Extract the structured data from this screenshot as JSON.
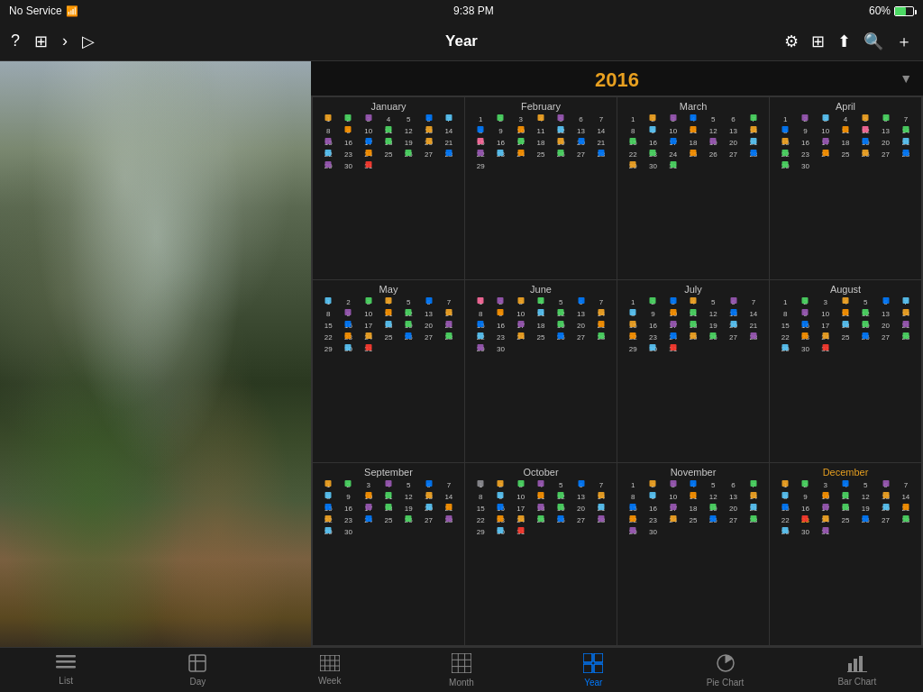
{
  "status_bar": {
    "carrier": "No Service",
    "time": "9:38 PM",
    "battery": "60%"
  },
  "nav_bar": {
    "title": "Year",
    "back_label": "‹",
    "icons": [
      "gear",
      "grid",
      "share",
      "search",
      "plus"
    ]
  },
  "calendar": {
    "year": "2016",
    "months": [
      {
        "name": "January",
        "is_current": false
      },
      {
        "name": "February",
        "is_current": false
      },
      {
        "name": "March",
        "is_current": false
      },
      {
        "name": "April",
        "is_current": false
      },
      {
        "name": "May",
        "is_current": false
      },
      {
        "name": "June",
        "is_current": false
      },
      {
        "name": "July",
        "is_current": false
      },
      {
        "name": "August",
        "is_current": false
      },
      {
        "name": "September",
        "is_current": false
      },
      {
        "name": "October",
        "is_current": false
      },
      {
        "name": "November",
        "is_current": false
      },
      {
        "name": "December",
        "is_current": true
      }
    ]
  },
  "tabs": [
    {
      "label": "List",
      "icon": "☰",
      "active": false
    },
    {
      "label": "Day",
      "icon": "▤",
      "active": false
    },
    {
      "label": "Week",
      "icon": "▦",
      "active": false
    },
    {
      "label": "Month",
      "icon": "⊞",
      "active": false
    },
    {
      "label": "Year",
      "icon": "⊟",
      "active": true
    },
    {
      "label": "Pie Chart",
      "icon": "◕",
      "active": false
    },
    {
      "label": "Bar Chart",
      "icon": "▬",
      "active": false
    }
  ]
}
